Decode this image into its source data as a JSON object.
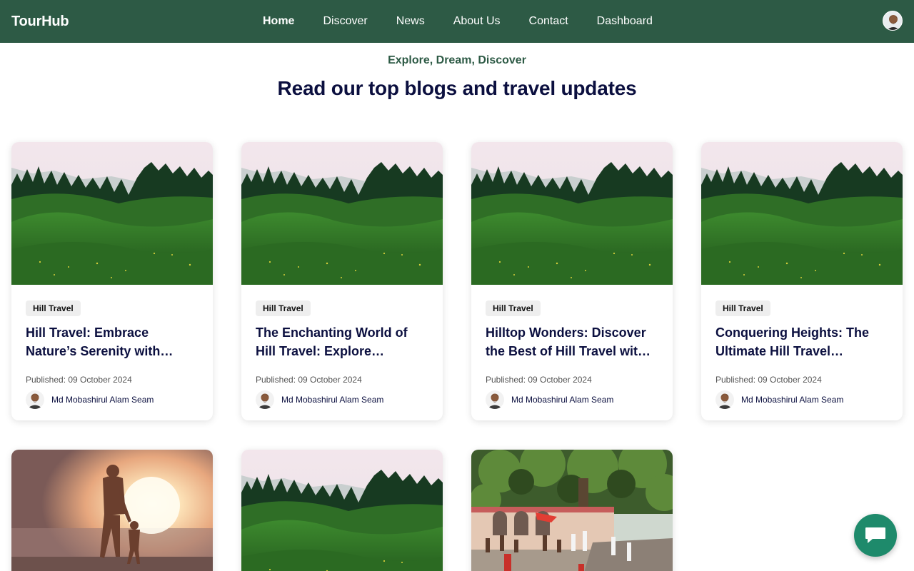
{
  "brand": "TourHub",
  "nav": {
    "links": [
      "Home",
      "Discover",
      "News",
      "About Us",
      "Contact",
      "Dashboard"
    ],
    "active": "Home"
  },
  "hero": {
    "eyebrow": "Explore, Dream, Discover",
    "headline": "Read our top blogs and travel updates"
  },
  "posts": [
    {
      "tag": "Hill Travel",
      "title": "Hill Travel: Embrace Nature’s Serenity with…",
      "published": "Published: 09 October 2024",
      "author": "Md Mobashirul Alam Seam",
      "image": "green-hills"
    },
    {
      "tag": "Hill Travel",
      "title": "The Enchanting World of Hill Travel: Explore…",
      "published": "Published: 09 October 2024",
      "author": "Md Mobashirul Alam Seam",
      "image": "green-hills"
    },
    {
      "tag": "Hill Travel",
      "title": "Hilltop Wonders: Discover the Best of Hill Travel wit…",
      "published": "Published: 09 October 2024",
      "author": "Md Mobashirul Alam Seam",
      "image": "green-hills"
    },
    {
      "tag": "Hill Travel",
      "title": "Conquering Heights: The Ultimate Hill Travel…",
      "published": "Published: 09 October 2024",
      "author": "Md Mobashirul Alam Seam",
      "image": "green-hills"
    },
    {
      "image": "beach-sunset"
    },
    {
      "image": "green-hills"
    },
    {
      "image": "temple-tree"
    }
  ],
  "colors": {
    "nav_bg": "#2d5a45",
    "accent": "#2d5a45",
    "heading": "#0b0f3f",
    "fab": "#1e8a6b"
  },
  "icons": {
    "chat": "chat-bubble-icon",
    "avatar": "user-avatar"
  }
}
